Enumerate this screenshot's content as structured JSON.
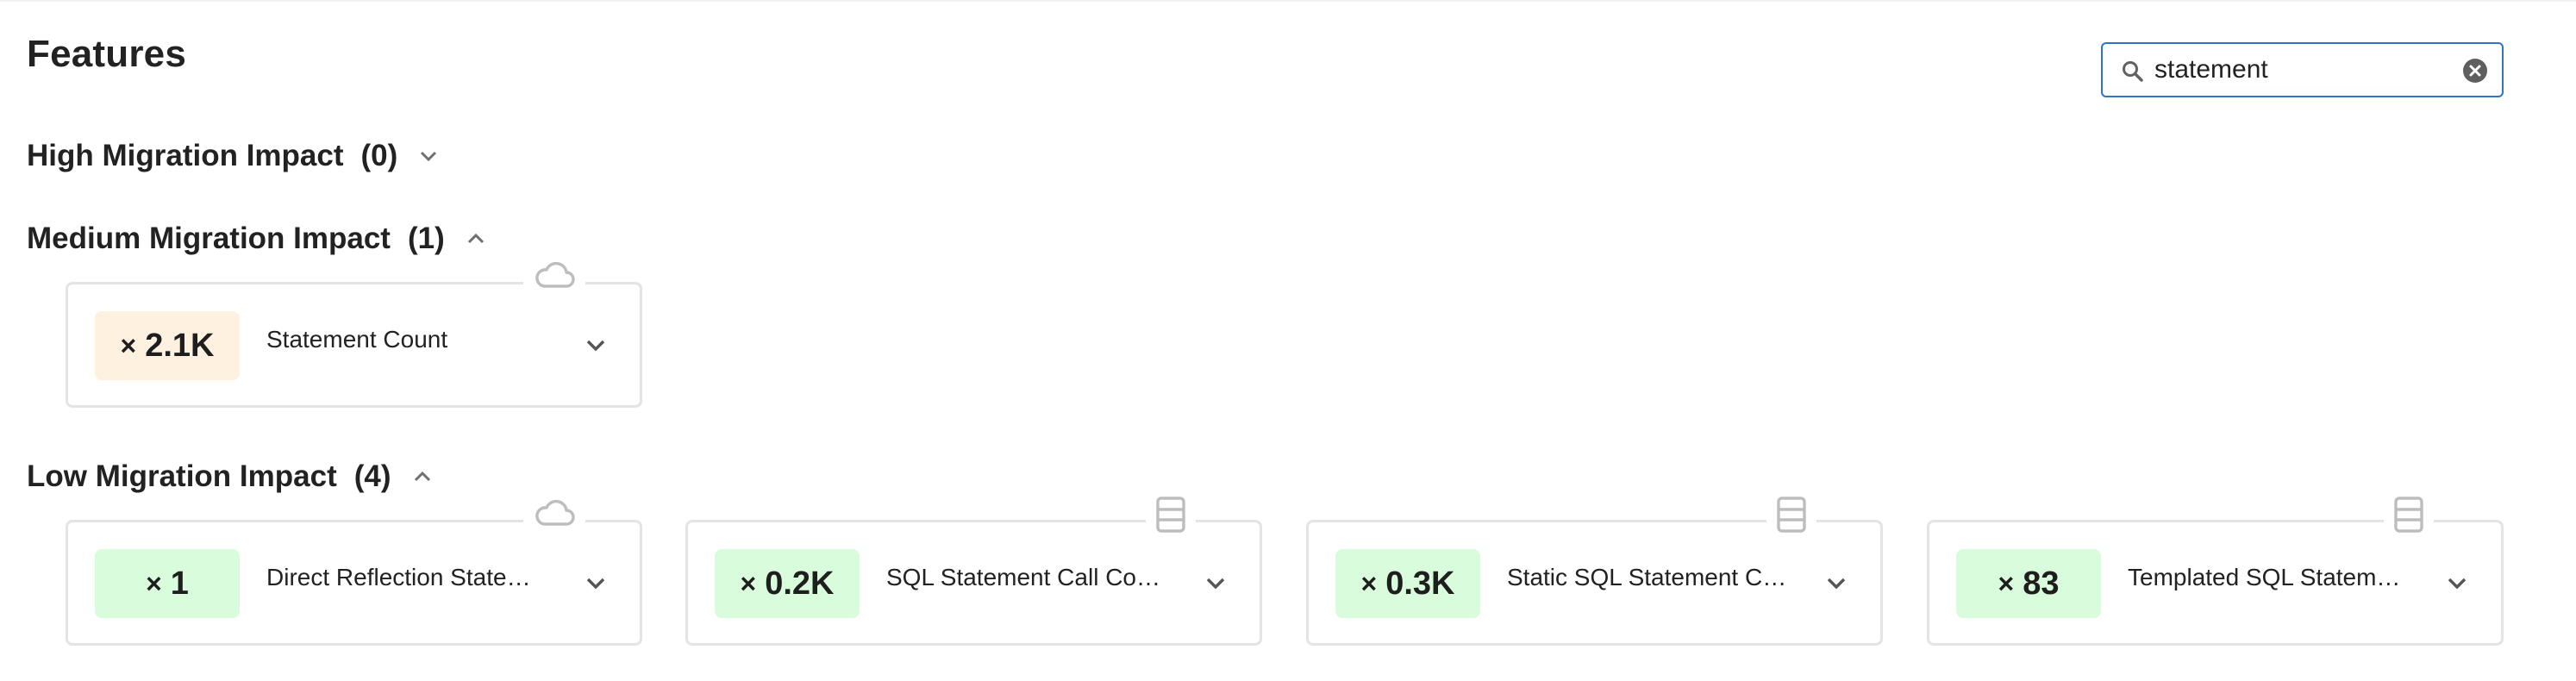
{
  "page": {
    "title": "Features"
  },
  "search": {
    "value": "statement",
    "placeholder": "",
    "search_icon": "search-icon",
    "clear_icon": "clear-circle-icon"
  },
  "sections": [
    {
      "title": "High Migration Impact",
      "count": "(0)",
      "expanded": false,
      "chevron_icon": "chevron-down-icon",
      "cards": []
    },
    {
      "title": "Medium Migration Impact",
      "count": "(1)",
      "expanded": true,
      "chevron_icon": "chevron-up-icon",
      "cards": [
        {
          "multiplier": "×",
          "value": "2.1K",
          "label": "Statement Count",
          "type_icon": "cloud-icon",
          "badge_color": "#fff1e0"
        }
      ]
    },
    {
      "title": "Low Migration Impact",
      "count": "(4)",
      "expanded": true,
      "chevron_icon": "chevron-up-icon",
      "cards": [
        {
          "multiplier": "×",
          "value": "1",
          "label": "Direct Reflection State…",
          "type_icon": "cloud-icon",
          "badge_color": "#d9fcdc"
        },
        {
          "multiplier": "×",
          "value": "0.2K",
          "label": "SQL Statement Call Cou…",
          "type_icon": "database-icon",
          "badge_color": "#d9fcdc"
        },
        {
          "multiplier": "×",
          "value": "0.3K",
          "label": "Static SQL Statement C…",
          "type_icon": "database-icon",
          "badge_color": "#d9fcdc"
        },
        {
          "multiplier": "×",
          "value": "83",
          "label": "Templated SQL Statem…",
          "type_icon": "database-icon",
          "badge_color": "#d9fcdc"
        }
      ]
    }
  ],
  "colors": {
    "accent_border": "#2f73c6",
    "medium_badge": "#fff1e0",
    "low_badge": "#d9fcdc",
    "card_border": "#e4e4e4",
    "icon_gray": "#bdbdbd"
  }
}
